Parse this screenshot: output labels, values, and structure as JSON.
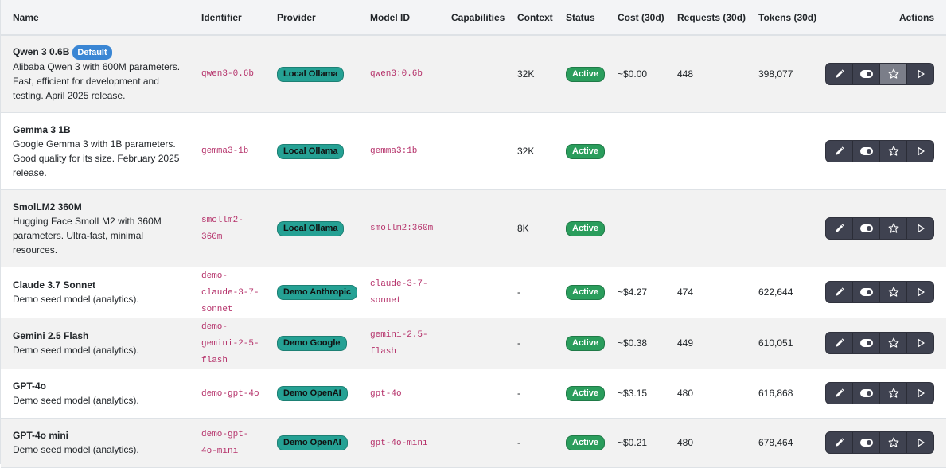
{
  "headers": {
    "name": "Name",
    "identifier": "Identifier",
    "provider": "Provider",
    "model_id": "Model ID",
    "capabilities": "Capabilities",
    "context": "Context",
    "status": "Status",
    "cost": "Cost (30d)",
    "requests": "Requests (30d)",
    "tokens": "Tokens (30d)",
    "actions": "Actions"
  },
  "rows": [
    {
      "name": "Qwen 3 0.6B",
      "badge": "Default",
      "desc": "Alibaba Qwen 3 with 600M parameters. Fast, efficient for development and testing. April 2025 release.",
      "identifier": "qwen3-0.6b",
      "provider": "Local Ollama",
      "model_id": "qwen3:0.6b",
      "capabilities": "",
      "context": "32K",
      "status": "Active",
      "cost": "~$0.00",
      "requests": "448",
      "tokens": "398,077"
    },
    {
      "name": "Gemma 3 1B",
      "badge": "",
      "desc": "Google Gemma 3 with 1B parameters. Good quality for its size. February 2025 release.",
      "identifier": "gemma3-1b",
      "provider": "Local Ollama",
      "model_id": "gemma3:1b",
      "capabilities": "",
      "context": "32K",
      "status": "Active",
      "cost": "",
      "requests": "",
      "tokens": ""
    },
    {
      "name": "SmolLM2 360M",
      "badge": "",
      "desc": "Hugging Face SmolLM2 with 360M parameters. Ultra-fast, minimal resources.",
      "identifier": "smollm2-360m",
      "provider": "Local Ollama",
      "model_id": "smollm2:360m",
      "capabilities": "",
      "context": "8K",
      "status": "Active",
      "cost": "",
      "requests": "",
      "tokens": ""
    },
    {
      "name": "Claude 3.7 Sonnet",
      "badge": "",
      "desc": "Demo seed model (analytics).",
      "identifier": "demo-claude-3-7-sonnet",
      "provider": "Demo Anthropic",
      "model_id": "claude-3-7-sonnet",
      "capabilities": "",
      "context": "-",
      "status": "Active",
      "cost": "~$4.27",
      "requests": "474",
      "tokens": "622,644"
    },
    {
      "name": "Gemini 2.5 Flash",
      "badge": "",
      "desc": "Demo seed model (analytics).",
      "identifier": "demo-gemini-2-5-flash",
      "provider": "Demo Google",
      "model_id": "gemini-2.5-flash",
      "capabilities": "",
      "context": "-",
      "status": "Active",
      "cost": "~$0.38",
      "requests": "449",
      "tokens": "610,051"
    },
    {
      "name": "GPT-4o",
      "badge": "",
      "desc": "Demo seed model (analytics).",
      "identifier": "demo-gpt-4o",
      "provider": "Demo OpenAI",
      "model_id": "gpt-4o",
      "capabilities": "",
      "context": "-",
      "status": "Active",
      "cost": "~$3.15",
      "requests": "480",
      "tokens": "616,868"
    },
    {
      "name": "GPT-4o mini",
      "badge": "",
      "desc": "Demo seed model (analytics).",
      "identifier": "demo-gpt-4o-mini",
      "provider": "Demo OpenAI",
      "model_id": "gpt-4o-mini",
      "capabilities": "",
      "context": "-",
      "status": "Active",
      "cost": "~$0.21",
      "requests": "480",
      "tokens": "678,464"
    }
  ],
  "action_icons": [
    "pencil-icon",
    "toggle-icon",
    "star-icon",
    "play-icon"
  ],
  "colors": {
    "default_badge": "#3a86d4",
    "provider_badge": "#25a194",
    "status_active": "#2a9d5c",
    "mono_text": "#b5316a",
    "action_button": "#3f4250"
  }
}
